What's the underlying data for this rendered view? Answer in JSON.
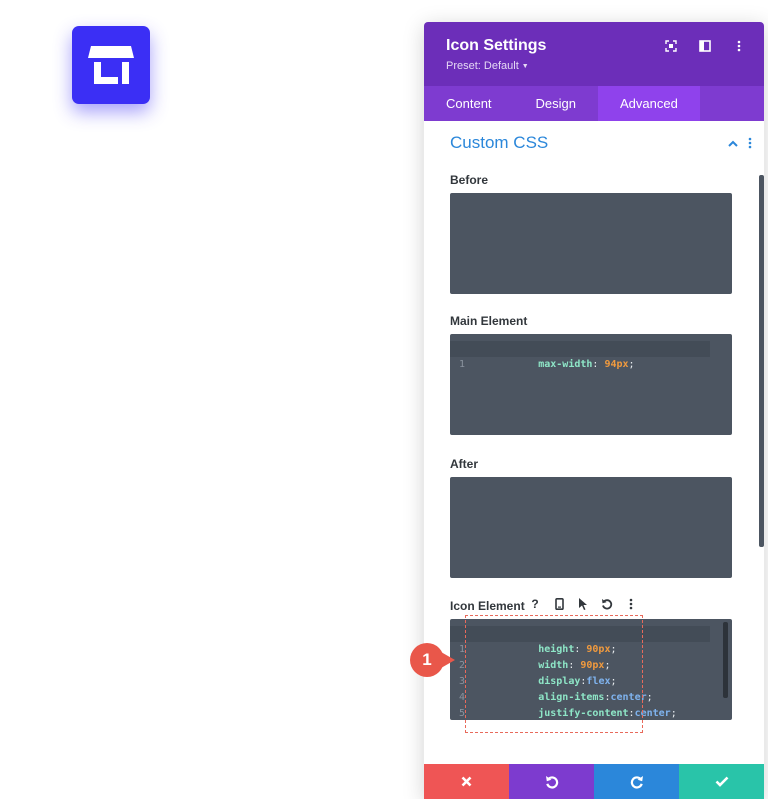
{
  "modal": {
    "title": "Icon Settings",
    "preset": "Preset: Default",
    "tabs": [
      {
        "label": "Content",
        "active": false
      },
      {
        "label": "Design",
        "active": false
      },
      {
        "label": "Advanced",
        "active": true
      }
    ]
  },
  "section": {
    "title": "Custom CSS"
  },
  "fields": {
    "before_label": "Before",
    "main_label": "Main Element",
    "after_label": "After",
    "icon_label": "Icon Element"
  },
  "main_code": [
    {
      "n": "1",
      "prop": "max-width",
      "sep": ": ",
      "val": "94px",
      "end": ";",
      "val_type": "num"
    }
  ],
  "icon_code": [
    {
      "n": "1",
      "prop": "height",
      "sep": ": ",
      "val": "90px",
      "end": ";",
      "val_type": "num"
    },
    {
      "n": "2",
      "prop": "width",
      "sep": ": ",
      "val": "90px",
      "end": ";",
      "val_type": "num"
    },
    {
      "n": "3",
      "prop": "display",
      "sep": ":",
      "val": "flex",
      "end": ";",
      "val_type": "kw"
    },
    {
      "n": "4",
      "prop": "align-items",
      "sep": ":",
      "val": "center",
      "end": ";",
      "val_type": "kw"
    },
    {
      "n": "5",
      "prop": "justify-content",
      "sep": ":",
      "val": "center",
      "end": ";",
      "val_type": "kw"
    }
  ],
  "icon_tools": [
    "?",
    "mobile-icon",
    "pointer-icon",
    "undo-icon",
    "more-vertical-icon"
  ],
  "annotation": {
    "badge": "1"
  },
  "colors": {
    "header": "#6c2eb9",
    "tabs": "#7e3bd0",
    "tab_active": "#8f42ec",
    "accent": "#2b87da",
    "code_bg": "#4c5561",
    "store_tile": "#3b2ff5",
    "cancel": "#ef5555",
    "undo": "#7d3bcf",
    "redo": "#2b87da",
    "save": "#29c4a9"
  }
}
